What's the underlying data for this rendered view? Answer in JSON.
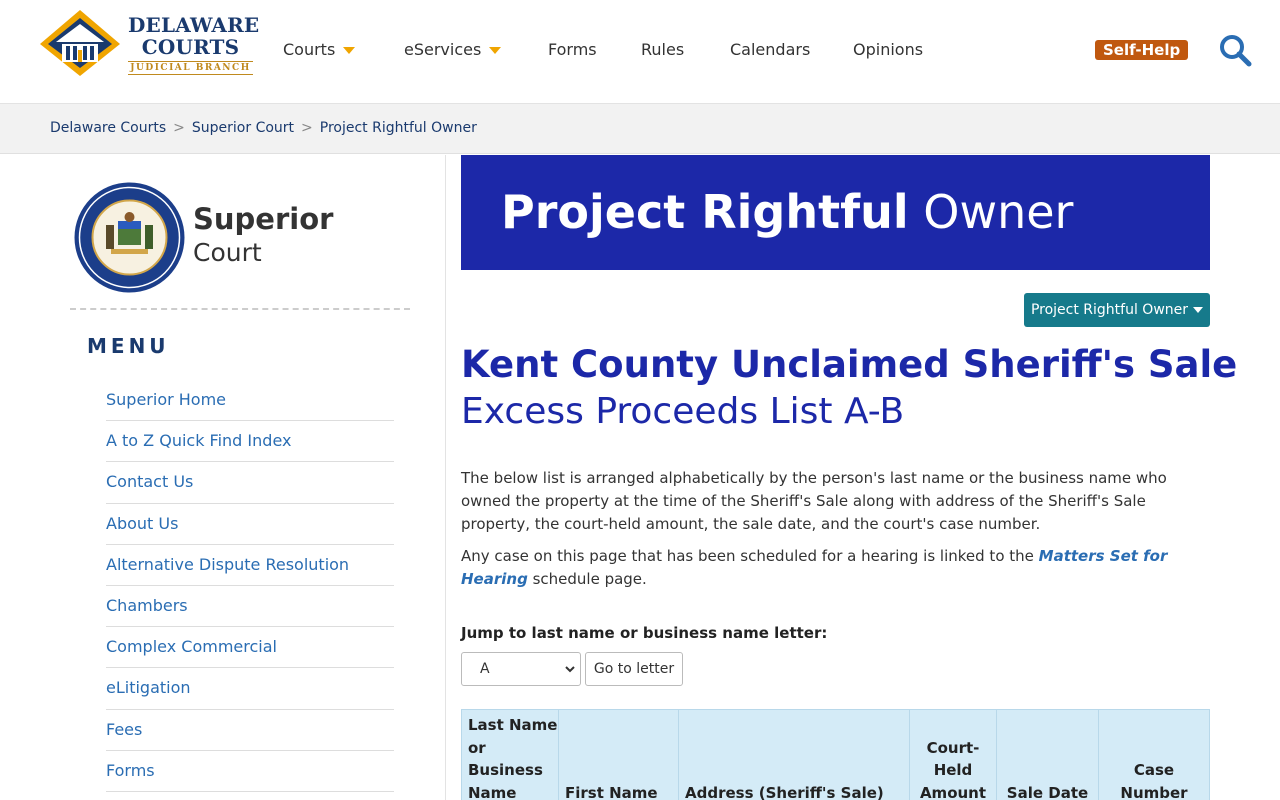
{
  "header": {
    "logo": {
      "line1": "DELAWARE",
      "line2": "COURTS",
      "line3": "JUDICIAL BRANCH"
    },
    "nav": [
      {
        "label": "Courts",
        "has_dropdown": true
      },
      {
        "label": "eServices",
        "has_dropdown": true
      },
      {
        "label": "Forms",
        "has_dropdown": false
      },
      {
        "label": "Rules",
        "has_dropdown": false
      },
      {
        "label": "Calendars",
        "has_dropdown": false
      },
      {
        "label": "Opinions",
        "has_dropdown": false
      }
    ],
    "self_help": "Self-Help",
    "search_icon": "search-icon"
  },
  "breadcrumb": [
    "Delaware Courts",
    "Superior Court",
    "Project Rightful Owner"
  ],
  "sidebar": {
    "court_name_bold": "Superior",
    "court_name_light": "Court",
    "menu_heading": "MENU",
    "menu_items": [
      "Superior Home",
      "A to Z Quick Find Index",
      "Contact Us",
      "About Us",
      "Alternative Dispute Resolution",
      "Chambers",
      "Complex Commercial",
      "eLitigation",
      "Fees",
      "Forms"
    ]
  },
  "main": {
    "banner_bold": "Project Rightful",
    "banner_light": "Owner",
    "dropdown_label": "Project Rightful Owner",
    "title": "Kent County Unclaimed Sheriff's Sale",
    "subtitle": "Excess Proceeds List A-B",
    "paragraph1": "The below list is arranged alphabetically by the person's last name or the business name who owned the property at the time of the Sheriff's Sale along with address of the Sheriff's Sale property, the court-held amount, the sale date, and the court's case number.",
    "paragraph2_before": "Any case on this page that has been scheduled for a hearing is linked to the ",
    "paragraph2_link": "Matters Set for Hearing",
    "paragraph2_after": " schedule page.",
    "jump_label": "Jump to last name or business name letter:",
    "letter_selected": "A",
    "go_button": "Go to letter",
    "table_headers": [
      "Last Name or Business Name",
      "First Name",
      "Address (Sheriff's Sale)",
      "Court-Held Amount",
      "Sale Date",
      "Case Number"
    ]
  },
  "colors": {
    "brand_blue": "#1c28a8",
    "navy": "#1a3a6e",
    "accent_orange": "#f0a500",
    "self_help_bg": "#c0580f",
    "teal_button": "#167a8b",
    "link_blue": "#2a6db3",
    "table_header_bg": "#d4ebf7"
  }
}
